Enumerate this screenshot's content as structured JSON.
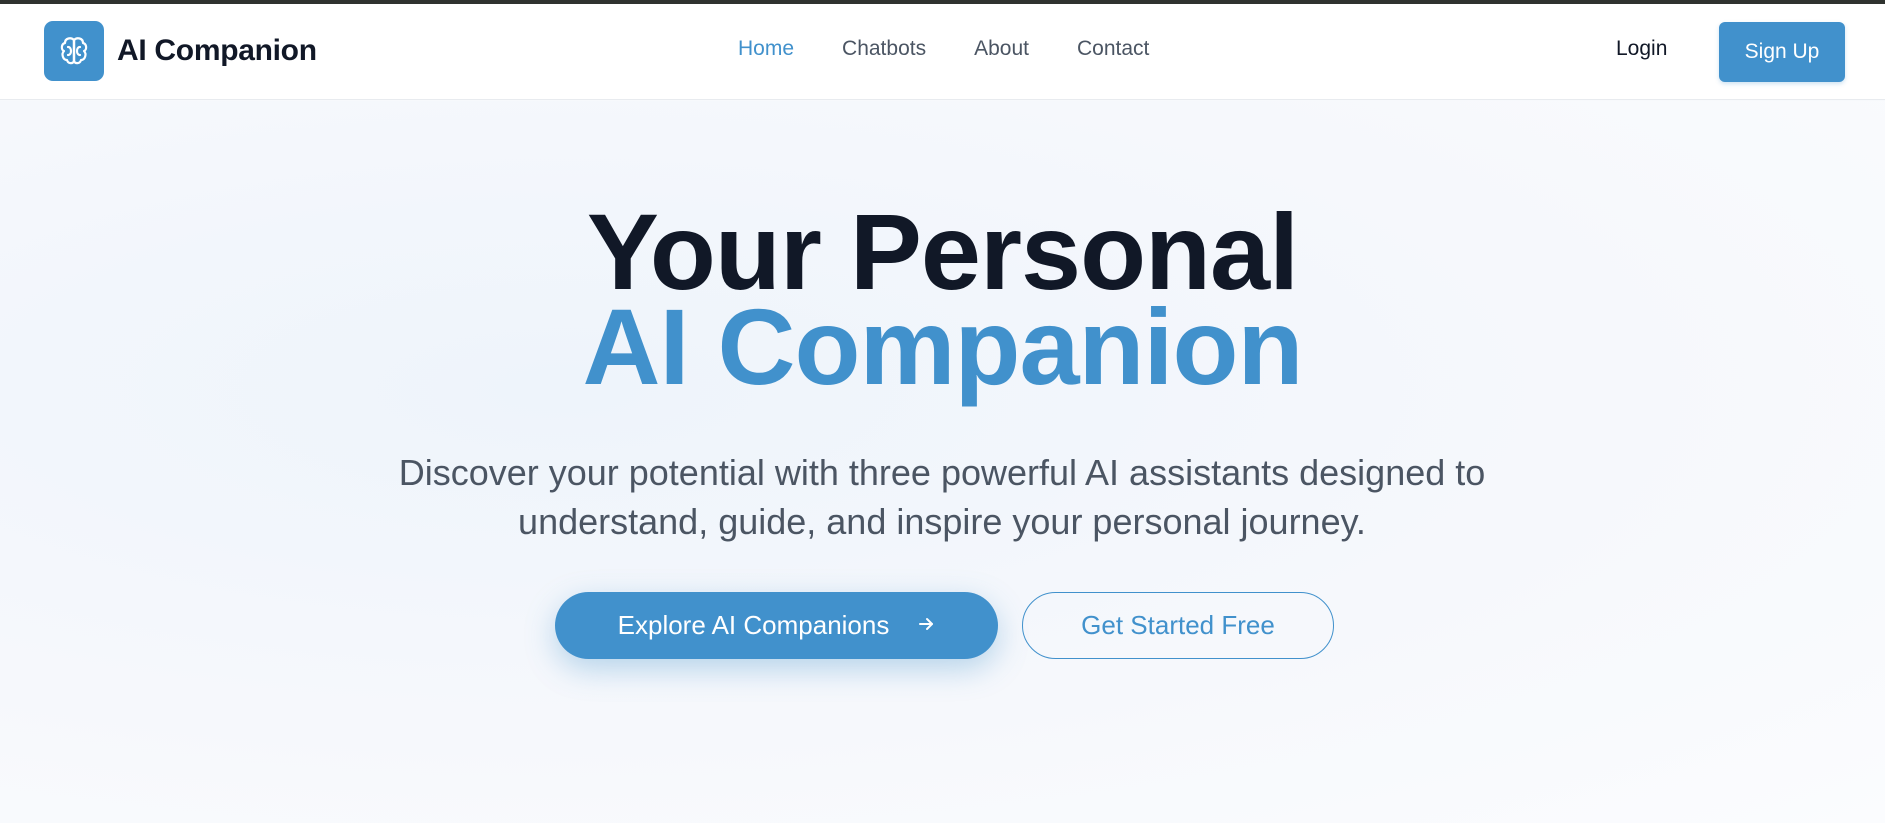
{
  "brand": {
    "name": "AI Companion",
    "logo_icon": "brain-icon",
    "accent": "#4191cc"
  },
  "nav": {
    "links": [
      {
        "label": "Home",
        "active": true
      },
      {
        "label": "Chatbots",
        "active": false
      },
      {
        "label": "About",
        "active": false
      },
      {
        "label": "Contact",
        "active": false
      }
    ],
    "login_label": "Login",
    "signup_label": "Sign Up"
  },
  "hero": {
    "headline_line1": "Your Personal",
    "headline_line2": "AI Companion",
    "subtitle": "Discover your potential with three powerful AI assistants designed to understand, guide, and inspire your personal journey.",
    "primary_cta": {
      "label": "Explore AI Companions",
      "icon": "arrow-right-icon"
    },
    "secondary_cta": {
      "label": "Get Started Free"
    }
  }
}
